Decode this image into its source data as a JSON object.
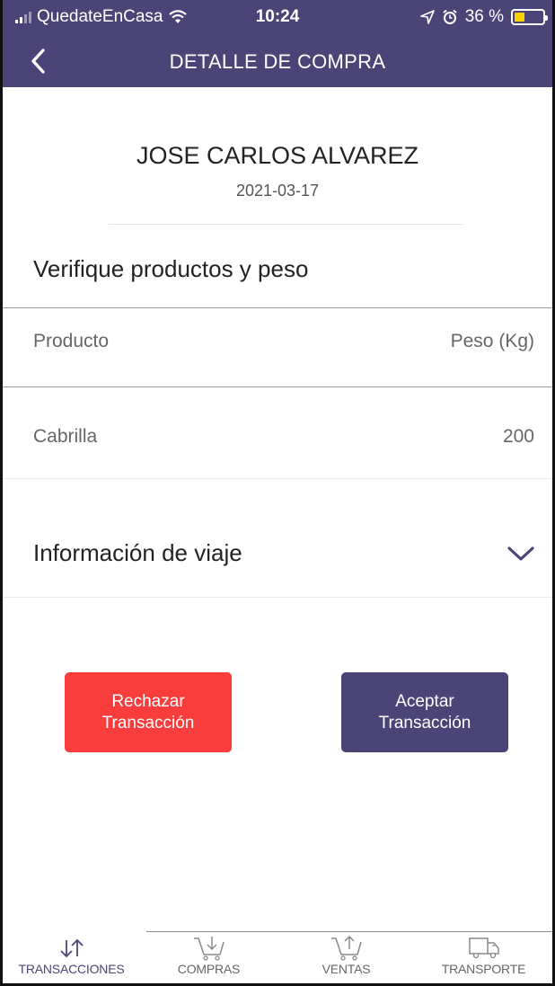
{
  "status_bar": {
    "carrier": "QuedateEnCasa",
    "time": "10:24",
    "battery_percent": "36 %",
    "battery_level": 0.36
  },
  "header": {
    "title": "DETALLE DE COMPRA",
    "back_icon": "chevron-left-icon"
  },
  "customer": {
    "name": "JOSE CARLOS ALVAREZ",
    "date": "2021-03-17"
  },
  "verify": {
    "title": "Verifique productos y peso",
    "columns": [
      "Producto",
      "Peso (Kg)"
    ],
    "rows": [
      {
        "product": "Cabrilla",
        "weight": "200"
      }
    ]
  },
  "trip": {
    "title": "Información de viaje",
    "icon": "chevron-down-icon"
  },
  "actions": {
    "reject_label": "Rechazar\nTransacción",
    "accept_label": "Aceptar\nTransacción"
  },
  "colors": {
    "primary": "#4b4577",
    "reject": "#f93d3d",
    "battery": "#f5d200"
  },
  "bottom_nav": [
    {
      "label": "TRANSACCIONES",
      "icon": "transactions-arrows-icon",
      "active": true
    },
    {
      "label": "COMPRAS",
      "icon": "cart-down-icon",
      "active": false
    },
    {
      "label": "VENTAS",
      "icon": "cart-up-icon",
      "active": false
    },
    {
      "label": "TRANSPORTE",
      "icon": "truck-icon",
      "active": false
    }
  ]
}
